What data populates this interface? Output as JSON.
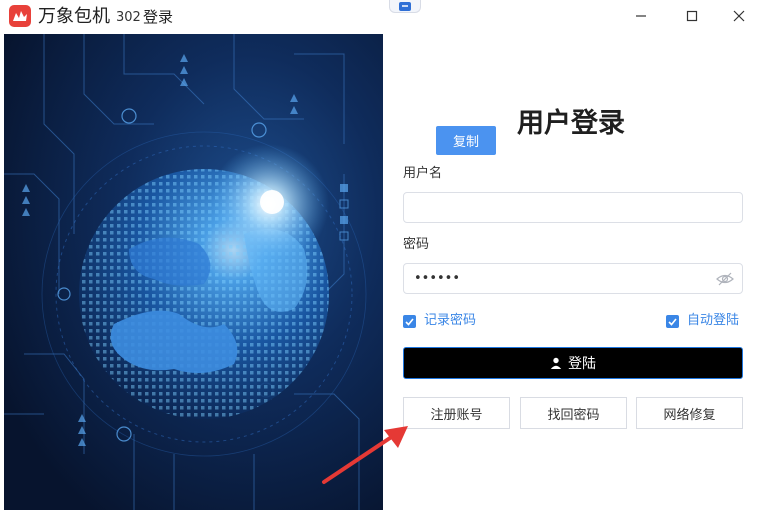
{
  "window": {
    "app_name": "万象包机",
    "version": "302",
    "subtitle": "登录",
    "controls": [
      "minimize",
      "maximize",
      "close"
    ]
  },
  "login": {
    "title": "用户登录",
    "copy_label": "复制",
    "username_label": "用户名",
    "username_value": "",
    "password_label": "密码",
    "password_value": "••••••",
    "remember_label": "记录密码",
    "remember_checked": true,
    "auto_login_label": "自动登陆",
    "auto_login_checked": true,
    "login_label": "登陆",
    "register_label": "注册账号",
    "recover_label": "找回密码",
    "repair_label": "网络修复"
  },
  "colors": {
    "accent": "#3a86e6",
    "copy_button": "#4b93f0",
    "login_button": "#000000",
    "arrow": "#e53935",
    "brand_icon": "#e8413a"
  }
}
